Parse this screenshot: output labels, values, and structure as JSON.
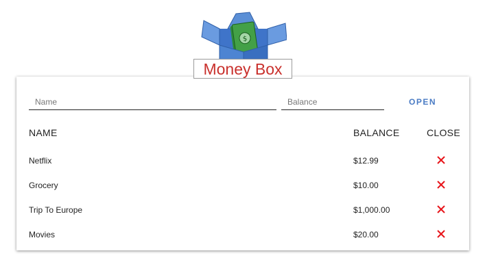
{
  "app": {
    "title": "Money Box"
  },
  "form": {
    "name_placeholder": "Name",
    "name_value": "",
    "balance_placeholder": "Balance",
    "balance_value": "",
    "open_label": "OPEN"
  },
  "table": {
    "headers": {
      "name": "NAME",
      "balance": "BALANCE",
      "close": "CLOSE"
    },
    "rows": [
      {
        "name": "Netflix",
        "balance": "$12.99"
      },
      {
        "name": "Grocery",
        "balance": "$10.00"
      },
      {
        "name": "Trip To Europe",
        "balance": "$1,000.00"
      },
      {
        "name": "Movies",
        "balance": "$20.00"
      }
    ]
  },
  "icons": {
    "logo": "money-box-icon",
    "close": "close-icon"
  },
  "colors": {
    "accent": "#4a7bc4",
    "title_red": "#c9302c",
    "close_red": "#e8161b",
    "box_blue": "#5b8fd6",
    "cash_green": "#4caf50"
  }
}
